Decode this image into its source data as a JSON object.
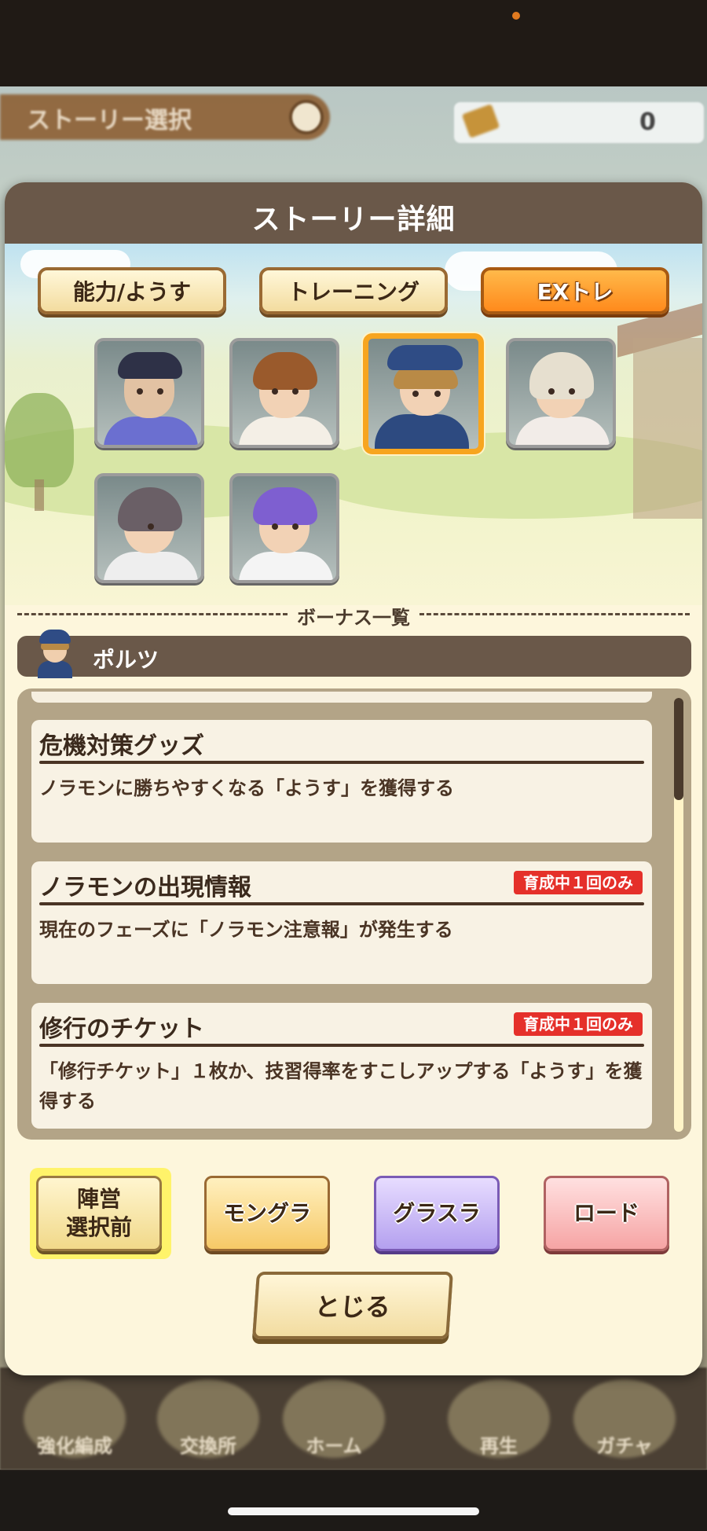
{
  "background": {
    "screen_title": "ストーリー選択",
    "currency_value": "0",
    "nav_items": [
      "強化編成",
      "交換所",
      "ホーム",
      "再生",
      "ガチャ"
    ]
  },
  "modal": {
    "title": "ストーリー詳細",
    "tabs": [
      {
        "label": "能力/ようす",
        "active": false
      },
      {
        "label": "トレーニング",
        "active": false
      },
      {
        "label": "EXトレ",
        "active": true
      }
    ],
    "characters": [
      {
        "id": "char-1",
        "selected": false
      },
      {
        "id": "char-2",
        "selected": false
      },
      {
        "id": "char-3",
        "selected": true
      },
      {
        "id": "char-4",
        "selected": false
      },
      {
        "id": "char-5",
        "selected": false
      },
      {
        "id": "char-6",
        "selected": false
      }
    ],
    "bonus_section_label": "ボーナス一覧",
    "selected_character_name": "ポルツ",
    "bonuses": [
      {
        "title": "危機対策グッズ",
        "description": "ノラモンに勝ちやすくなる「ようす」を獲得する",
        "badge": ""
      },
      {
        "title": "ノラモンの出現情報",
        "description": "現在のフェーズに「ノラモン注意報」が発生する",
        "badge": "育成中１回のみ"
      },
      {
        "title": "修行のチケット",
        "description": "「修行チケット」１枚か、技習得率をすこしアップする「ようす」を獲得する",
        "badge": "育成中１回のみ"
      }
    ],
    "mode_buttons": [
      {
        "line1": "陣営",
        "line2": "選択前"
      },
      {
        "label": "モングラ"
      },
      {
        "label": "グラスラ"
      },
      {
        "label": "ロード"
      }
    ],
    "close_label": "とじる"
  },
  "colors": {
    "header_brown": "#6a5849",
    "active_tab_orange": "#ff8a1c",
    "selected_border": "#f7a51f",
    "badge_red": "#e5302a",
    "panel_cream": "#fdf6dc"
  }
}
